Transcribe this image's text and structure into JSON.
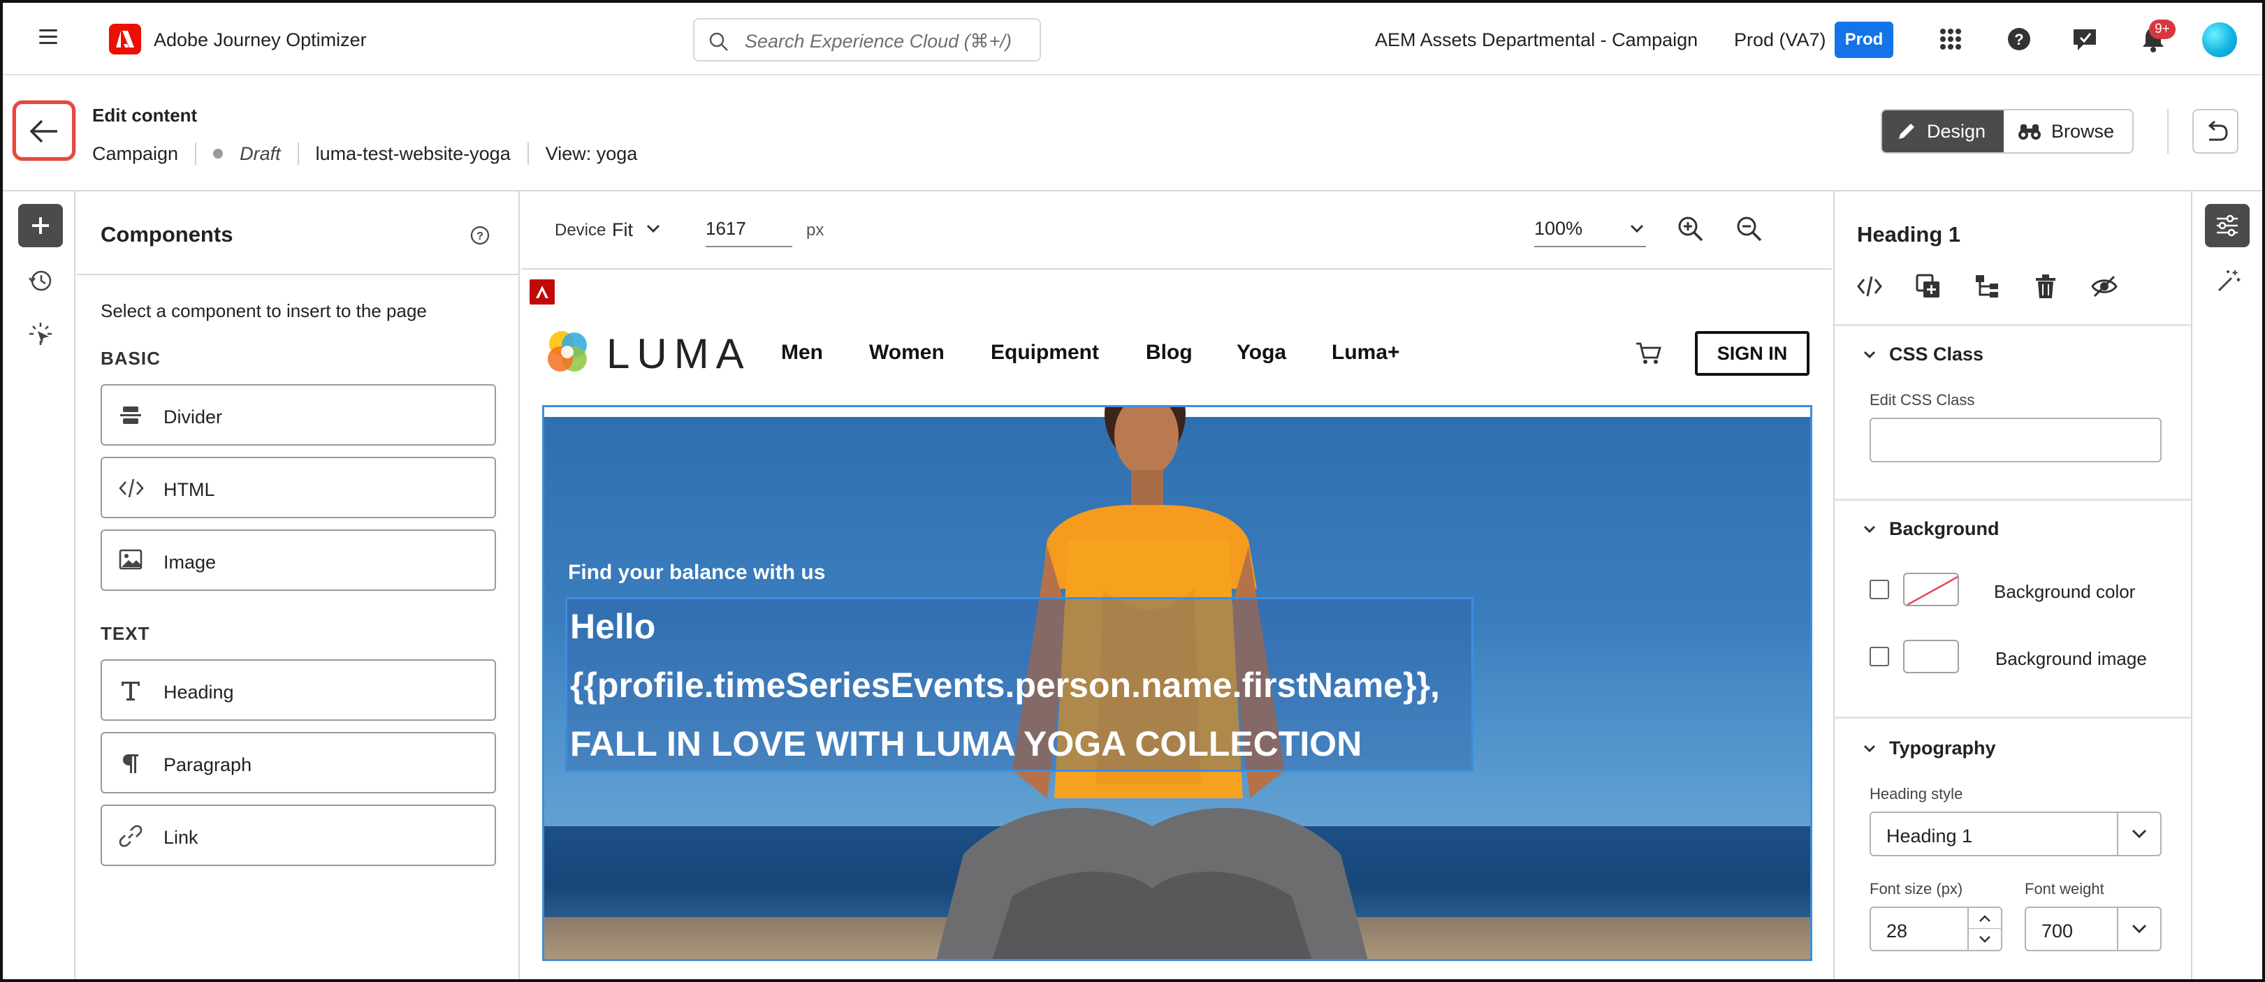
{
  "topnav": {
    "app_title": "Adobe Journey Optimizer",
    "search_placeholder": "Search Experience Cloud (⌘+/)",
    "org_name": "AEM Assets Departmental - Campaign",
    "environment": "Prod (VA7)",
    "prod_button": "Prod",
    "notification_badge": "9+",
    "icons": [
      "menu-icon",
      "adobe-logo-icon",
      "search-icon",
      "apps-grid-icon",
      "help-icon",
      "feedback-icon",
      "bell-icon",
      "avatar"
    ]
  },
  "header": {
    "title": "Edit content",
    "breadcrumb": {
      "type": "Campaign",
      "status": "Draft",
      "surface": "luma-test-website-yoga",
      "view": "View: yoga"
    },
    "modes": {
      "design": "Design",
      "browse": "Browse"
    },
    "active_mode": "design"
  },
  "components_panel": {
    "title": "Components",
    "description": "Select a component to insert to the page",
    "basic_label": "BASIC",
    "basic_items": [
      {
        "label": "Divider"
      },
      {
        "label": "HTML"
      },
      {
        "label": "Image"
      }
    ],
    "text_label": "TEXT",
    "text_items": [
      {
        "label": "Heading"
      },
      {
        "label": "Paragraph"
      },
      {
        "label": "Link"
      }
    ]
  },
  "canvas_toolbar": {
    "device_label": "Device",
    "device_value": "Fit",
    "width_value": "1617",
    "width_unit": "px",
    "zoom_value": "100%"
  },
  "page": {
    "brand": "LUMA",
    "nav": [
      "Men",
      "Women",
      "Equipment",
      "Blog",
      "Yoga",
      "Luma+"
    ],
    "sign_in": "SIGN IN",
    "hero_subtitle": "Find your balance with us",
    "hero_line1": "Hello",
    "hero_line2": "{{profile.timeSeriesEvents.person.name.firstName}},",
    "hero_line3": "FALL IN LOVE WITH LUMA YOGA COLLECTION"
  },
  "properties": {
    "title": "Heading 1",
    "css_class": {
      "heading": "CSS Class",
      "label": "Edit CSS Class",
      "value": ""
    },
    "background": {
      "heading": "Background",
      "color_label": "Background color",
      "image_label": "Background image"
    },
    "typography": {
      "heading": "Typography",
      "style_label": "Heading style",
      "style_value": "Heading 1",
      "font_size_label": "Font size (px)",
      "font_size_value": "28",
      "font_weight_label": "Font weight",
      "font_weight_value": "700"
    }
  },
  "colors": {
    "accent_blue": "#1473e6",
    "adobe_red": "#eb1000",
    "highlight_red": "#e8483e",
    "selection_blue": "#3d8ee0",
    "dark_button": "#4b4b4b"
  }
}
